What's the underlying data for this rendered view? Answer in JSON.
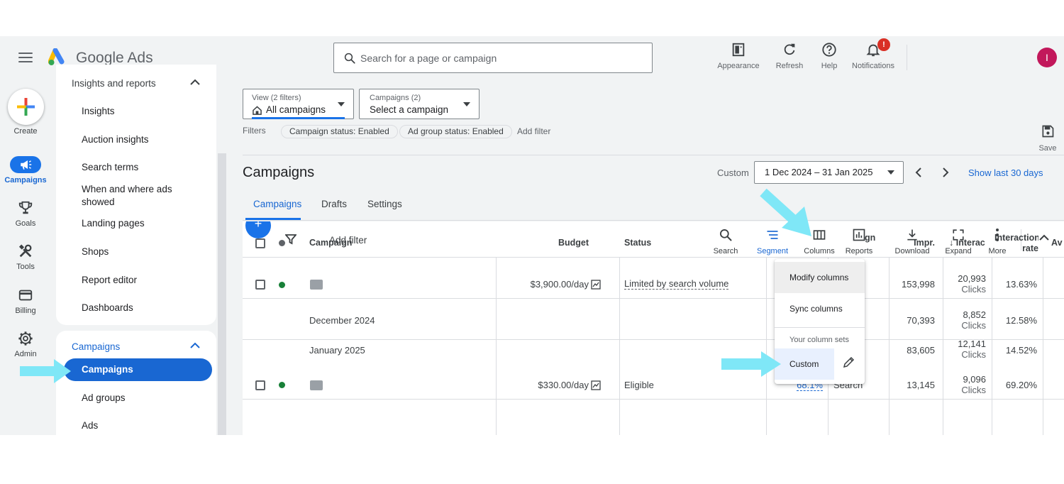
{
  "header": {
    "brand": "Google Ads",
    "search_placeholder": "Search for a page or campaign",
    "tools": [
      {
        "label": "Appearance",
        "icon": "appearance-icon"
      },
      {
        "label": "Refresh",
        "icon": "refresh-icon"
      },
      {
        "label": "Help",
        "icon": "help-icon"
      },
      {
        "label": "Notifications",
        "icon": "notifications-icon",
        "badge": "!"
      }
    ],
    "avatar_initial": "I"
  },
  "rail": {
    "create_label": "Create",
    "items": [
      {
        "label": "Campaigns",
        "icon": "campaigns-icon",
        "active": true
      },
      {
        "label": "Goals",
        "icon": "trophy-icon"
      },
      {
        "label": "Tools",
        "icon": "tools-icon"
      },
      {
        "label": "Billing",
        "icon": "billing-icon"
      },
      {
        "label": "Admin",
        "icon": "admin-gear-icon"
      }
    ]
  },
  "nav": {
    "section1": {
      "title": "Insights and reports",
      "items": [
        "Insights",
        "Auction insights",
        "Search terms",
        "When and where ads showed",
        "Landing pages",
        "Shops",
        "Report editor",
        "Dashboards"
      ]
    },
    "section2": {
      "title": "Campaigns",
      "items": [
        "Campaigns",
        "Ad groups",
        "Ads"
      ],
      "active": "Campaigns"
    }
  },
  "filters": {
    "view_small": "View (2 filters)",
    "view_main": "All campaigns",
    "campaign_small": "Campaigns (2)",
    "campaign_main": "Select a campaign",
    "label": "Filters",
    "chips": [
      "Campaign status: Enabled",
      "Ad group status: Enabled"
    ],
    "add_filter": "Add filter",
    "save_label": "Save"
  },
  "page": {
    "title": "Campaigns",
    "date_label": "Custom",
    "date_range": "1 Dec 2024 – 31 Jan 2025",
    "show_last": "Show last 30 days",
    "tabs": [
      "Campaigns",
      "Drafts",
      "Settings"
    ]
  },
  "toolbar": {
    "add_filter": "Add filter",
    "tools": [
      {
        "label": "Search",
        "icon": "search-icon"
      },
      {
        "label": "Segment",
        "icon": "segment-icon",
        "active": true
      },
      {
        "label": "Columns",
        "icon": "columns-icon"
      },
      {
        "label": "Reports",
        "icon": "reports-icon"
      },
      {
        "label": "Download",
        "icon": "download-icon"
      },
      {
        "label": "Expand",
        "icon": "expand-icon"
      },
      {
        "label": "More",
        "icon": "more-vert-icon"
      }
    ]
  },
  "table": {
    "headers": {
      "campaign": "Campaign",
      "budget": "Budget",
      "status": "Status",
      "type_partial": "gn",
      "impr": "Impr.",
      "interactions": "Interac",
      "interaction_rate_l1": "Interaction",
      "interaction_rate_l2": "rate",
      "avg": "Av"
    },
    "rows": [
      {
        "budget": "$3,900.00/day",
        "status": "Limited by search volume",
        "impr": "153,998",
        "interactions": "20,993",
        "interactions_unit": "Clicks",
        "rate": "13.63%"
      },
      {
        "segment": "December 2024",
        "impr": "70,393",
        "interactions": "8,852",
        "interactions_unit": "Clicks",
        "rate": "12.58%"
      },
      {
        "segment": "January 2025",
        "impr": "83,605",
        "interactions": "12,141",
        "interactions_unit": "Clicks",
        "rate": "14.52%"
      },
      {
        "budget": "$330.00/day",
        "status": "Eligible",
        "opt_score": "68.1%",
        "type": "Search",
        "impr": "13,145",
        "interactions": "9,096",
        "interactions_unit": "Clicks",
        "rate": "69.20%"
      }
    ]
  },
  "columns_menu": {
    "items": [
      "Modify columns",
      "Sync columns"
    ],
    "section": "Your column sets",
    "custom": "Custom"
  },
  "colors": {
    "primary": "#1a73e8",
    "active_nav": "#1967d2",
    "enabled_dot": "#188038",
    "annotation_arrow": "#7fe7f7"
  }
}
